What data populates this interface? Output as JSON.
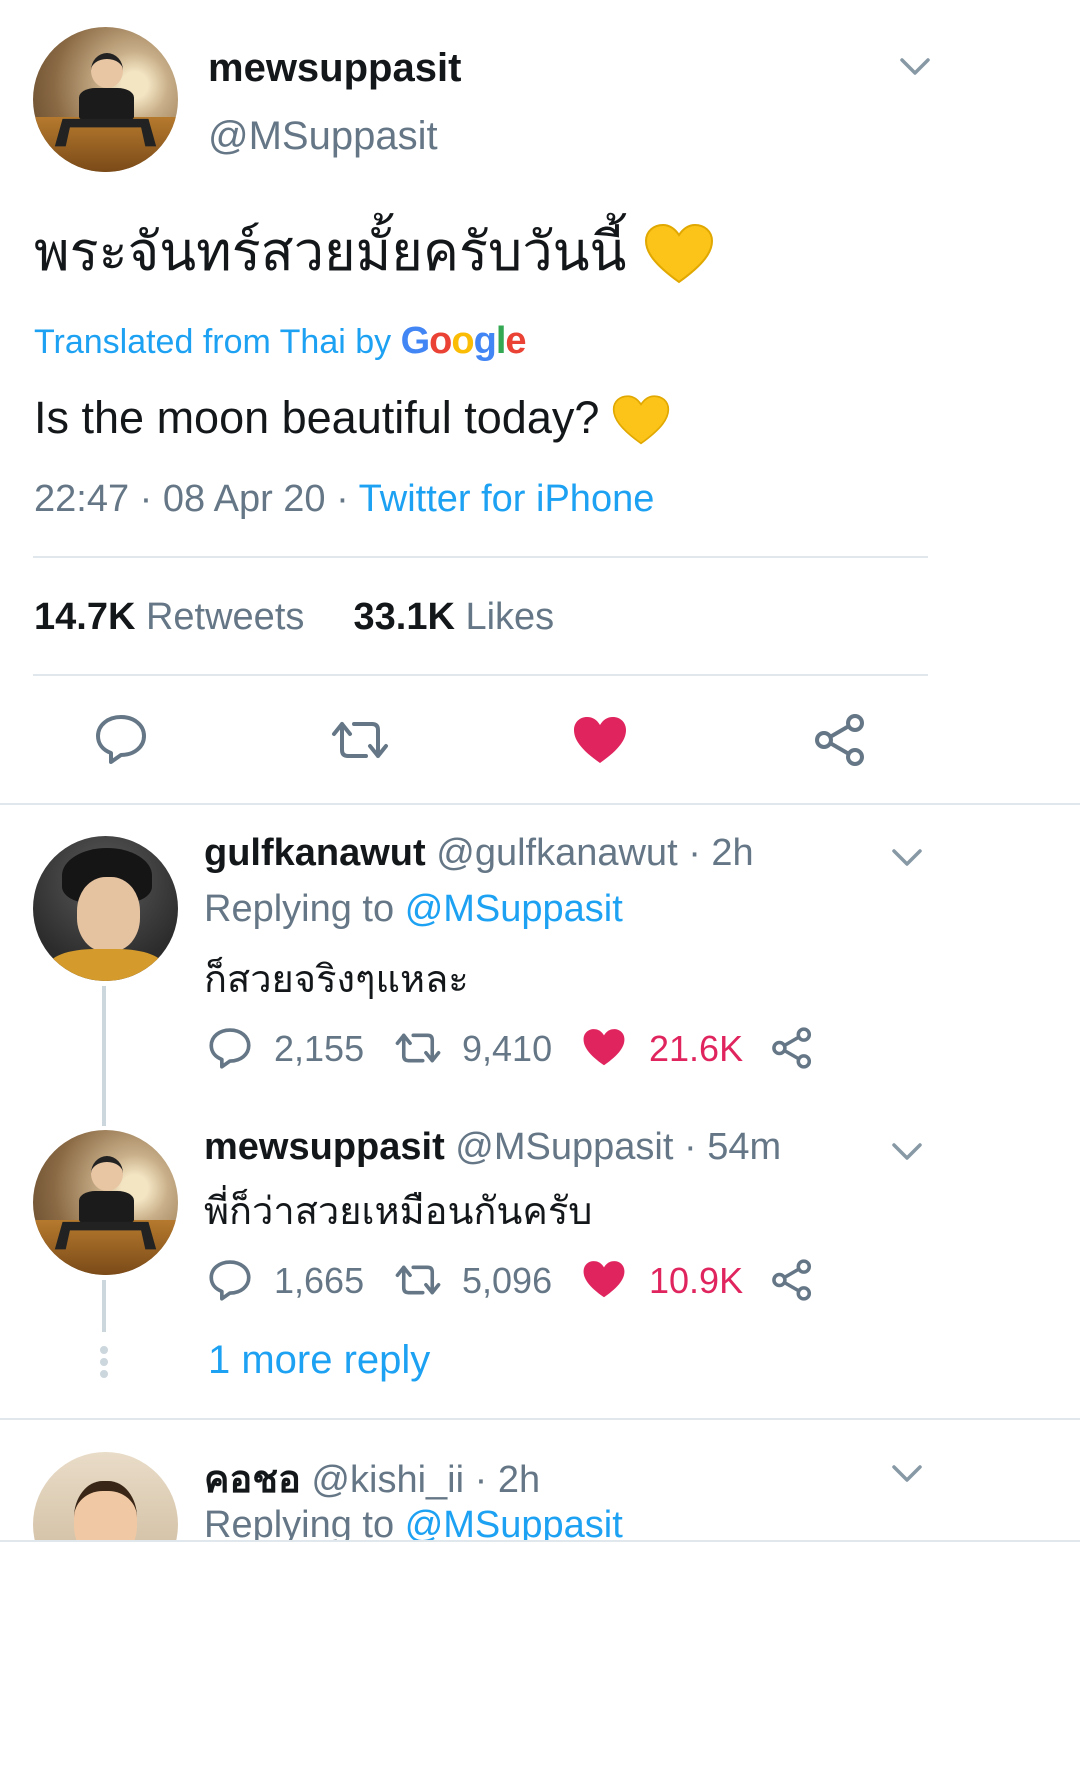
{
  "main_tweet": {
    "display_name": "mewsuppasit",
    "handle": "@MSuppasit",
    "text": "พระจันทร์สวยมั้ยครับวันนี้",
    "translated_prefix": "Translated from Thai by",
    "translator_brand": "Google",
    "translation": "Is the moon beautiful today?",
    "time": "22:47",
    "date": "08 Apr 20",
    "source": "Twitter for iPhone",
    "retweets_count": "14.7K",
    "retweets_label": "Retweets",
    "likes_count": "33.1K",
    "likes_label": "Likes"
  },
  "replies": [
    {
      "display_name": "gulfkanawut",
      "handle": "@gulfkanawut",
      "time": "2h",
      "replying_to_label": "Replying to",
      "replying_to": "@MSuppasit",
      "text": "ก็สวยจริงๆแหละ",
      "replies_count": "2,155",
      "retweets_count": "9,410",
      "likes_count": "21.6K"
    },
    {
      "display_name": "mewsuppasit",
      "handle": "@MSuppasit",
      "time": "54m",
      "text": "พี่ก็ว่าสวยเหมือนกันครับ",
      "replies_count": "1,665",
      "retweets_count": "5,096",
      "likes_count": "10.9K",
      "more_replies": "1 more reply"
    },
    {
      "display_name": "คอชอ",
      "handle": "@kishi_ii",
      "time": "2h",
      "replying_to_label": "Replying to",
      "replying_to": "@MSuppasit"
    }
  ],
  "colors": {
    "link": "#1da1f2",
    "like": "#e0245e",
    "secondary_text": "#657786",
    "divider": "#e1e8ed"
  }
}
